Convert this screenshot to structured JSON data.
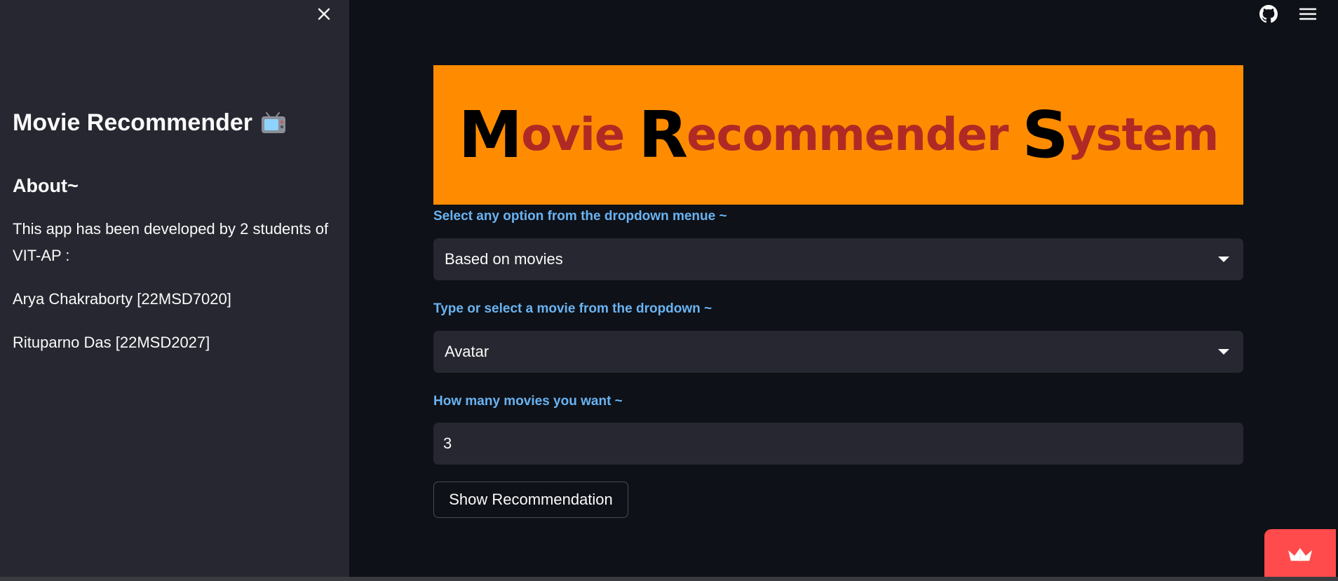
{
  "sidebar": {
    "title": "Movie Recommender",
    "title_icon": "tv-icon",
    "about_heading": "About~",
    "about_text": "This app has been developed by 2 students of VIT-AP :",
    "developers": [
      "Arya Chakraborty [22MSD7020]",
      "Rituparno Das [22MSD2027]"
    ]
  },
  "toolbar": {
    "close_icon": "close-icon",
    "github_icon": "github-icon",
    "menu_icon": "hamburger-menu-icon"
  },
  "banner": {
    "word1_cap": "M",
    "word1_rest": "ovie",
    "word2_cap": "R",
    "word2_rest": "ecommender",
    "word3_cap": "S",
    "word3_rest": "ystem",
    "background_color": "#ff8c00",
    "cap_color": "#000000",
    "rest_color": "#b02a25"
  },
  "form": {
    "option_label": "Select any option from the dropdown menue ~",
    "option_value": "Based on movies",
    "movie_label": "Type or select a movie from the dropdown ~",
    "movie_value": "Avatar",
    "count_label": "How many movies you want ~",
    "count_value": "3",
    "button_label": "Show Recommendation"
  },
  "colors": {
    "sidebar_bg": "#262730",
    "main_bg": "#0e1117",
    "label_color": "#69b3f2",
    "badge_color": "#ff4b4b"
  }
}
